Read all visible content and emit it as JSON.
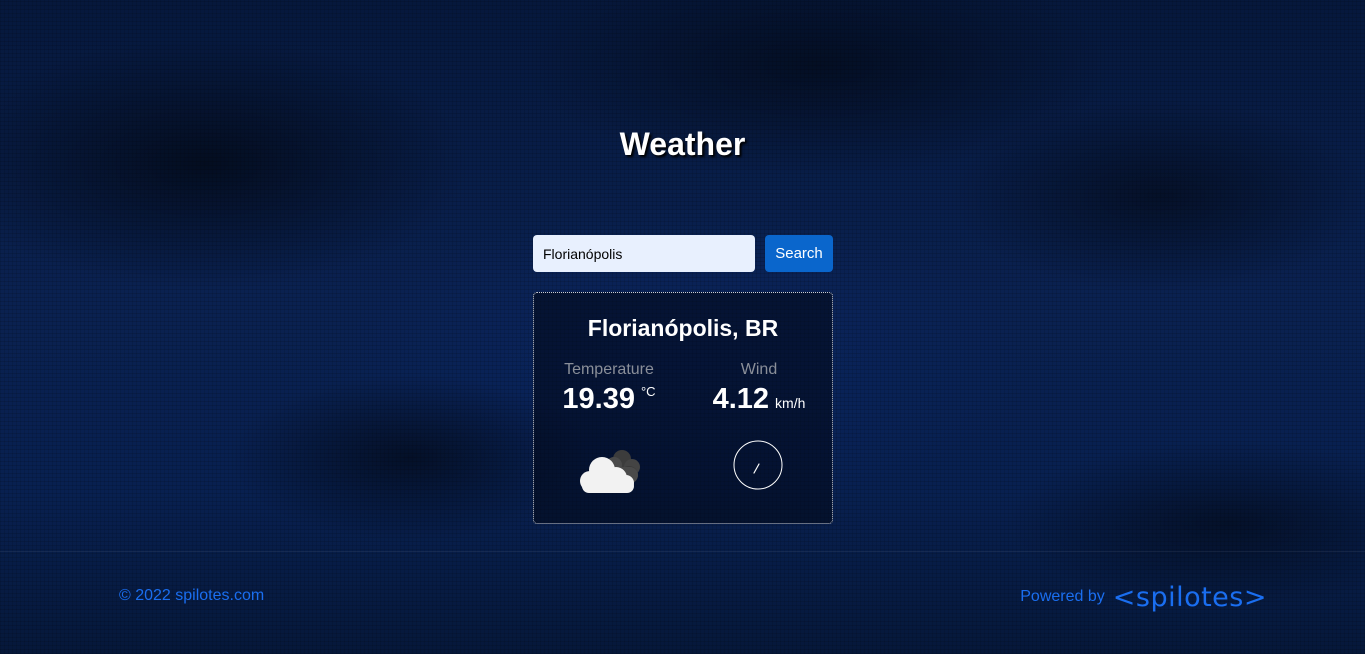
{
  "app": {
    "title": "Weather"
  },
  "search": {
    "value": "Florianópolis",
    "button_label": "Search"
  },
  "weather": {
    "location": "Florianópolis, BR",
    "temperature": {
      "label": "Temperature",
      "value": "19.39",
      "unit": "°C",
      "icon": "cloud-icon"
    },
    "wind": {
      "label": "Wind",
      "value": "4.12",
      "unit": "km/h",
      "icon": "wind-direction-dial-icon"
    }
  },
  "footer": {
    "copyright": "© 2022 spilotes.com",
    "powered_by_label": "Powered by",
    "brand": "<spilotes>"
  },
  "colors": {
    "accent": "#0a66cc",
    "link": "#1a6ef0",
    "input_bg": "#e8f0fe",
    "background": "#0a2150"
  }
}
